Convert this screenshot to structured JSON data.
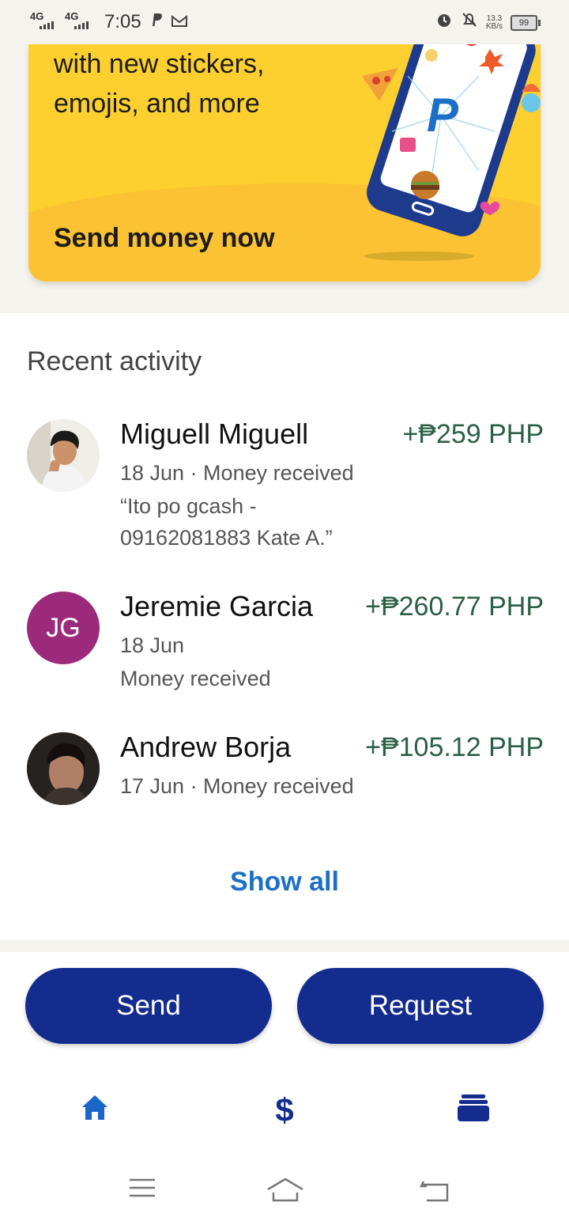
{
  "status_bar": {
    "signal1_label": "4G",
    "signal2_label": "4G",
    "time": "7:05",
    "speed_value": "13.3",
    "speed_unit": "KB/s",
    "battery": "99"
  },
  "promo": {
    "line1": "with new stickers,",
    "line2": "emojis, and more",
    "cta": "Send money now",
    "colors": {
      "bg": "#fdd02f",
      "wave": "#fbc233"
    }
  },
  "activity": {
    "title": "Recent activity",
    "items": [
      {
        "name": "Miguell Miguell",
        "amount": "+₱259 PHP",
        "line1": "18 Jun · Money received",
        "line2": "“Ito po gcash -",
        "line3": "09162081883 Kate A.”"
      },
      {
        "name": "Jeremie Garcia",
        "initials": "JG",
        "amount": "+₱260.77 PHP",
        "line1": "18 Jun",
        "line2": "Money received"
      },
      {
        "name": "Andrew Borja",
        "amount": "+₱105.12 PHP",
        "line1": "17 Jun · Money received"
      }
    ],
    "show_all": "Show all"
  },
  "actions": {
    "send": "Send",
    "request": "Request"
  },
  "colors": {
    "primary": "#142c8e",
    "link": "#1b6fc6",
    "amount": "#2b6046",
    "initials_bg": "#9c2a7a"
  }
}
